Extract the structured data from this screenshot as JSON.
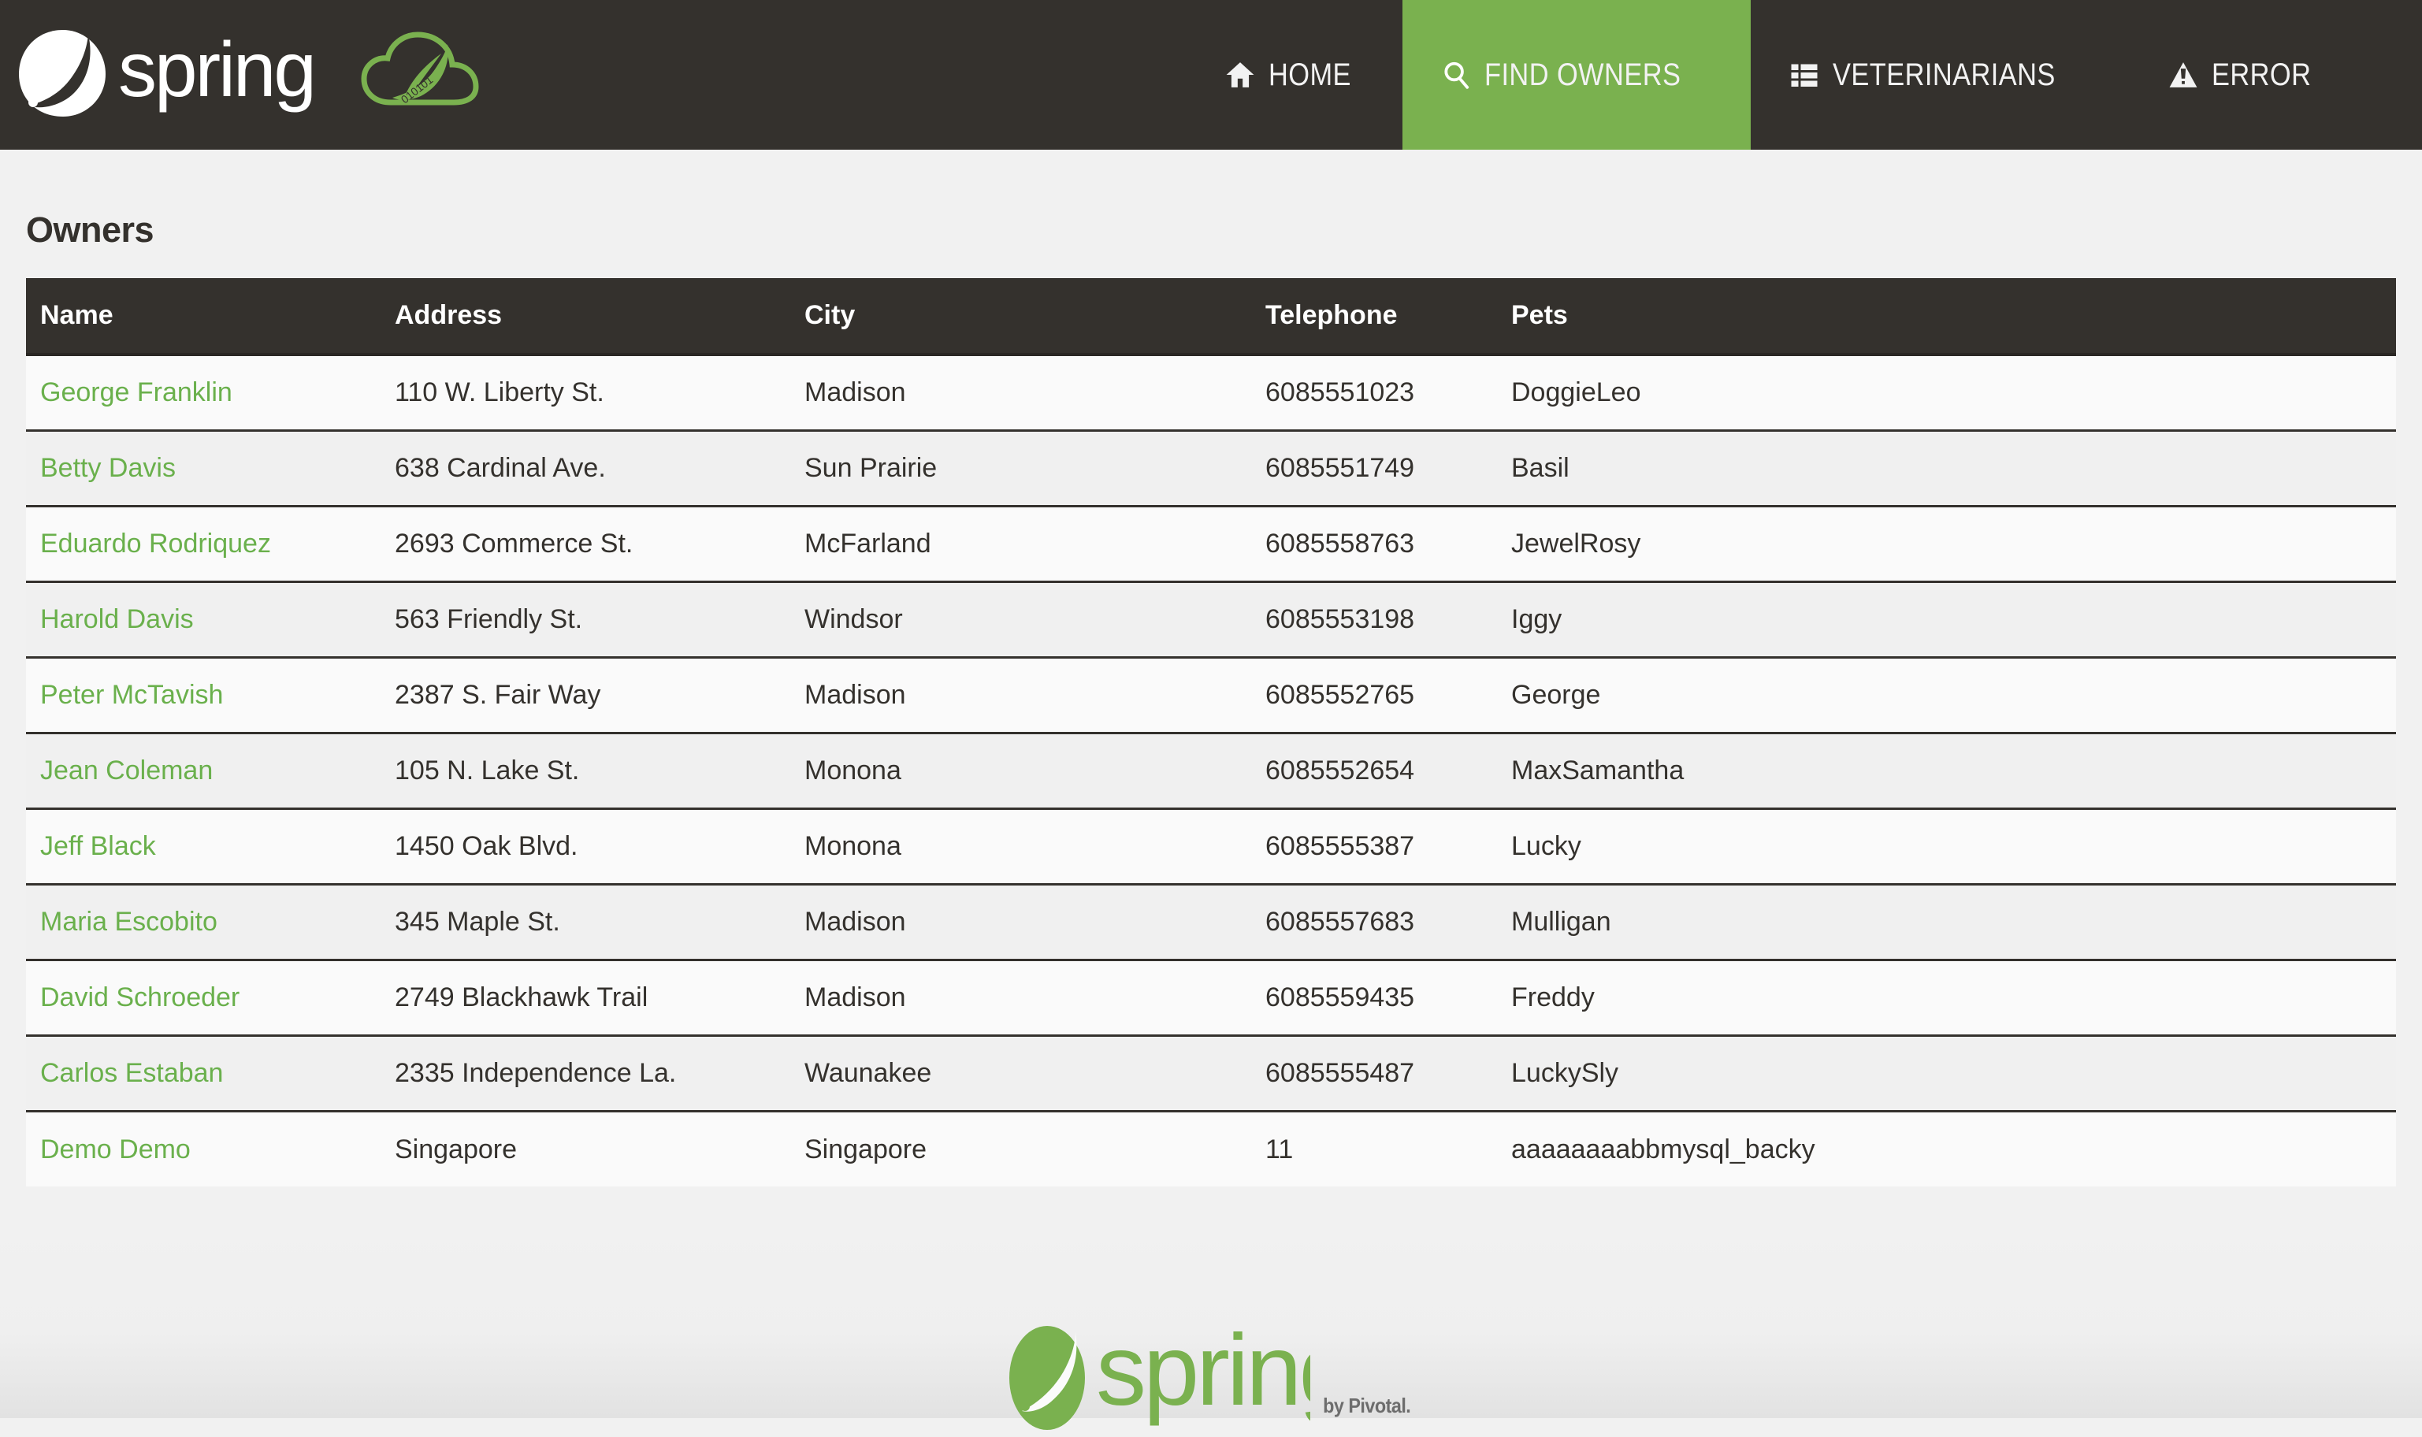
{
  "brand": {
    "name": "spring",
    "leaf_icon": "spring-leaf-icon",
    "cloud_icon": "spring-cloud-leaf-icon"
  },
  "nav": {
    "items": [
      {
        "id": "home",
        "label": "HOME",
        "icon": "home-icon",
        "active": false
      },
      {
        "id": "find-owners",
        "label": "FIND OWNERS",
        "icon": "search-icon",
        "active": true
      },
      {
        "id": "veterinarians",
        "label": "VETERINARIANS",
        "icon": "list-icon",
        "active": false
      },
      {
        "id": "error",
        "label": "ERROR",
        "icon": "warning-icon",
        "active": false
      }
    ]
  },
  "page": {
    "title": "Owners"
  },
  "table": {
    "columns": [
      "Name",
      "Address",
      "City",
      "Telephone",
      "Pets"
    ],
    "rows": [
      {
        "name": "George Franklin",
        "address": "110 W. Liberty St.",
        "city": "Madison",
        "telephone": "6085551023",
        "pets": "DoggieLeo"
      },
      {
        "name": "Betty Davis",
        "address": "638 Cardinal Ave.",
        "city": "Sun Prairie",
        "telephone": "6085551749",
        "pets": "Basil"
      },
      {
        "name": "Eduardo Rodriquez",
        "address": "2693 Commerce St.",
        "city": "McFarland",
        "telephone": "6085558763",
        "pets": "JewelRosy"
      },
      {
        "name": "Harold Davis",
        "address": "563 Friendly St.",
        "city": "Windsor",
        "telephone": "6085553198",
        "pets": "Iggy"
      },
      {
        "name": "Peter McTavish",
        "address": "2387 S. Fair Way",
        "city": "Madison",
        "telephone": "6085552765",
        "pets": "George"
      },
      {
        "name": "Jean Coleman",
        "address": "105 N. Lake St.",
        "city": "Monona",
        "telephone": "6085552654",
        "pets": "MaxSamantha"
      },
      {
        "name": "Jeff Black",
        "address": "1450 Oak Blvd.",
        "city": "Monona",
        "telephone": "6085555387",
        "pets": "Lucky"
      },
      {
        "name": "Maria Escobito",
        "address": "345 Maple St.",
        "city": "Madison",
        "telephone": "6085557683",
        "pets": "Mulligan"
      },
      {
        "name": "David Schroeder",
        "address": "2749 Blackhawk Trail",
        "city": "Madison",
        "telephone": "6085559435",
        "pets": "Freddy"
      },
      {
        "name": "Carlos Estaban",
        "address": "2335 Independence La.",
        "city": "Waunakee",
        "telephone": "6085555487",
        "pets": "LuckySly"
      },
      {
        "name": "Demo Demo",
        "address": "Singapore",
        "city": "Singapore",
        "telephone": "11",
        "pets": "aaaaaaaabbmysql_backy"
      }
    ]
  },
  "footer": {
    "logo_text": "spring",
    "byline": "by Pivotal."
  },
  "colors": {
    "navbar_bg": "#34312d",
    "accent_green": "#7ab14f",
    "link_green": "#6ab04c",
    "page_bg": "#f1f1f1",
    "row_odd": "#fafafa",
    "row_even": "#f0f0f0"
  }
}
